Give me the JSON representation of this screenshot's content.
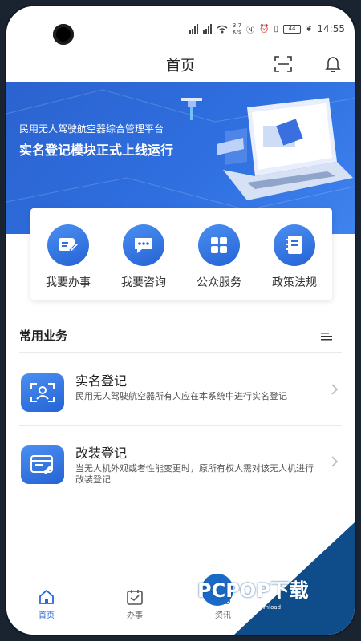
{
  "status_bar": {
    "time": "14:55",
    "speed": "3.7\nK/s",
    "battery": "44"
  },
  "header": {
    "title": "首页"
  },
  "banner": {
    "subtitle": "民用无人驾驶航空器综合管理平台",
    "headline": "实名登记模块正式上线运行"
  },
  "quick_actions": [
    {
      "label": "我要办事",
      "icon": "edit-doc-icon"
    },
    {
      "label": "我要咨询",
      "icon": "chat-icon"
    },
    {
      "label": "公众服务",
      "icon": "grid-icon"
    },
    {
      "label": "政策法规",
      "icon": "notebook-icon"
    }
  ],
  "section": {
    "title": "常用业务"
  },
  "services": [
    {
      "title": "实名登记",
      "desc": "民用无人驾驶航空器所有人应在本系统中进行实名登记",
      "icon": "id-face-icon"
    },
    {
      "title": "改装登记",
      "desc": "当无人机外观或者性能变更时，原所有权人需对该无人机进行改装登记",
      "icon": "browser-edit-icon"
    }
  ],
  "tabs": [
    {
      "label": "首页",
      "icon": "home-icon",
      "active": true
    },
    {
      "label": "办事",
      "icon": "calendar-check-icon",
      "active": false
    },
    {
      "label": "资讯",
      "icon": "news-icon",
      "active": false
    }
  ],
  "watermark": {
    "logo": "PCPOP下载",
    "sub": "PCPOP Download"
  },
  "colors": {
    "accent": "#2a66d6",
    "banner": "#2f6fe0",
    "watermark": "#0f4c8a"
  }
}
